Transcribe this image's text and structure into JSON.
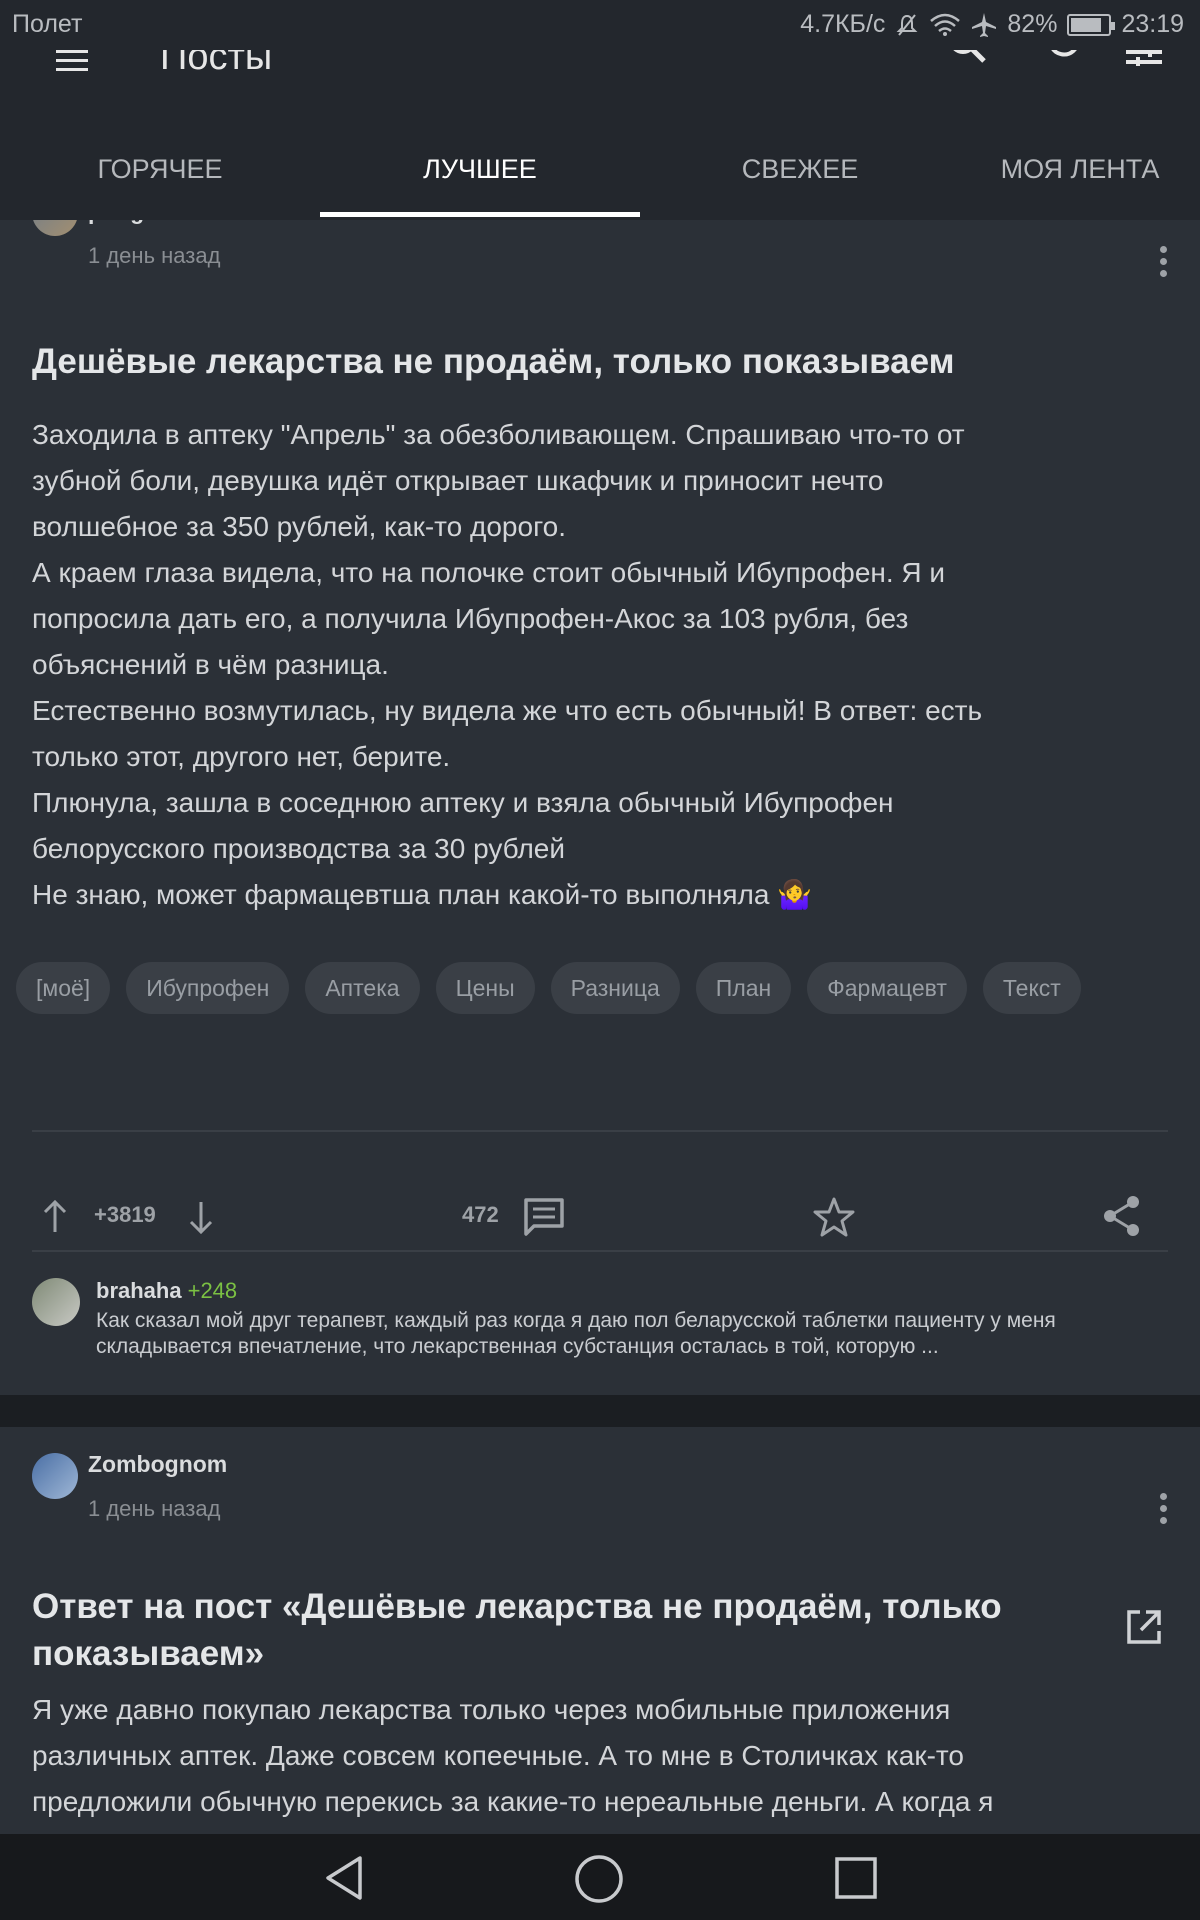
{
  "status_bar": {
    "carrier": "Полет",
    "speed": "4.7КБ/с",
    "battery": "82%",
    "battery_level": 0.82,
    "time": "23:19"
  },
  "app_bar": {
    "title": "Посты",
    "icons": [
      "menu-icon",
      "search-icon",
      "refresh-icon",
      "filter-icon"
    ]
  },
  "tabs": [
    {
      "label": "ГОРЯЧЕЕ",
      "active": false
    },
    {
      "label": "ЛУЧШЕЕ",
      "active": true
    },
    {
      "label": "СВЕЖЕЕ",
      "active": false
    },
    {
      "label": "МОЯ ЛЕНТА",
      "active": false
    }
  ],
  "post1": {
    "author": "poogramisto",
    "time": "1 день назад",
    "title": "Дешёвые лекарства не продаём, только показываем",
    "body_lines": [
      "Заходила в аптеку \"Апрель\" за обезболивающем. Спрашиваю что-то от",
      "зубной боли, девушка идёт открывает шкафчик и приносит нечто",
      "волшебное за 350 рублей, как-то дорого.",
      "А краем глаза видела, что на полочке стоит обычный Ибупрофен. Я и",
      "попросила дать его, а получила Ибупрофен-Акос за 103 рубля, без",
      "объяснений в чём разница.",
      "Естественно возмутилась, ну видела же что есть обычный! В ответ: есть",
      "только этот, другого нет, берите.",
      "Плюнула, зашла в соседнюю аптеку и взяла обычный Ибупрофен",
      "белорусского производства за 30 рублей",
      "Не знаю, может фармацевтша план какой-то выполняла 🤷‍♀️"
    ],
    "tags": [
      "[моё]",
      "Ибупрофен",
      "Аптека",
      "Цены",
      "Разница",
      "План",
      "Фармацевт",
      "Текст"
    ],
    "rating": "+3819",
    "comments_count": "472",
    "top_comment": {
      "author": "brahaha",
      "score": "+248",
      "text": "Как сказал мой друг терапевт, каждый раз когда я даю пол беларусской таблетки пациенту у меня складывается впечатление, что лекарственная субстанция осталась в той, которую ..."
    }
  },
  "post2": {
    "author": "Zombognom",
    "time": "1 день назад",
    "title": "Ответ на пост «Дешёвые лекарства не продаём, только показываем»",
    "body_lines": [
      "Я уже давно покупаю лекарства только через мобильные приложения",
      "различных аптек. Даже совсем копеечные. А то мне в Столичках как-то",
      "предложили обычную перекись за какие-то нереальные деньги. А когда я"
    ]
  }
}
